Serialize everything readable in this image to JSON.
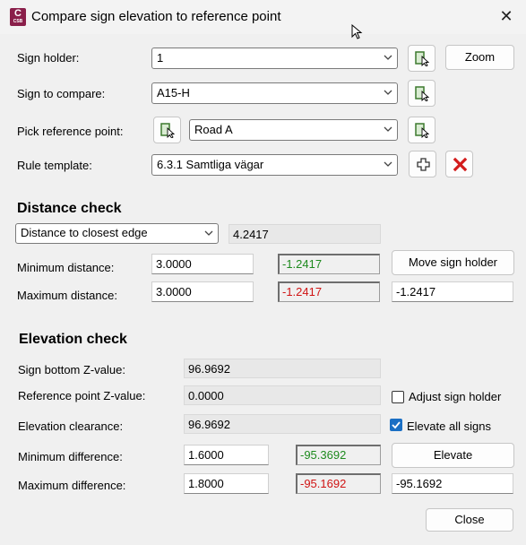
{
  "window": {
    "title": "Compare sign elevation to reference point",
    "close": "✕",
    "app_icon_letter": "C",
    "app_icon_sub": "CSB"
  },
  "top": {
    "sign_holder_label": "Sign holder:",
    "sign_holder_value": "1",
    "zoom_label": "Zoom",
    "sign_compare_label": "Sign to compare:",
    "sign_compare_value": "A15-H",
    "pick_ref_label": "Pick reference point:",
    "pick_ref_value": "Road A",
    "rule_template_label": "Rule template:",
    "rule_template_value": "6.3.1 Samtliga vägar"
  },
  "distance": {
    "heading": "Distance check",
    "mode_value": "Distance to closest edge",
    "mode_result": "4.2417",
    "min_label": "Minimum distance:",
    "min_value": "3.0000",
    "min_result": "-1.2417",
    "max_label": "Maximum distance:",
    "max_value": "3.0000",
    "max_result": "-1.2417",
    "move_label": "Move sign holder",
    "move_value": "-1.2417"
  },
  "elevation": {
    "heading": "Elevation check",
    "bottom_label": "Sign bottom Z-value:",
    "bottom_value": "96.9692",
    "ref_label": "Reference point Z-value:",
    "ref_value": "0.0000",
    "clearance_label": "Elevation clearance:",
    "clearance_value": "96.9692",
    "adjust_label": "Adjust sign holder",
    "adjust_checked": false,
    "elevate_all_label": "Elevate all signs",
    "elevate_all_checked": true,
    "min_label": "Minimum difference:",
    "min_value": "1.6000",
    "min_result": "-95.3692",
    "max_label": "Maximum difference:",
    "max_value": "1.8000",
    "max_result": "-95.1692",
    "elevate_label": "Elevate",
    "elevate_value": "-95.1692"
  },
  "footer": {
    "close_label": "Close"
  },
  "colors": {
    "ok": "#1e8a1e",
    "fail": "#d01414",
    "accent": "#1a6fc4"
  }
}
